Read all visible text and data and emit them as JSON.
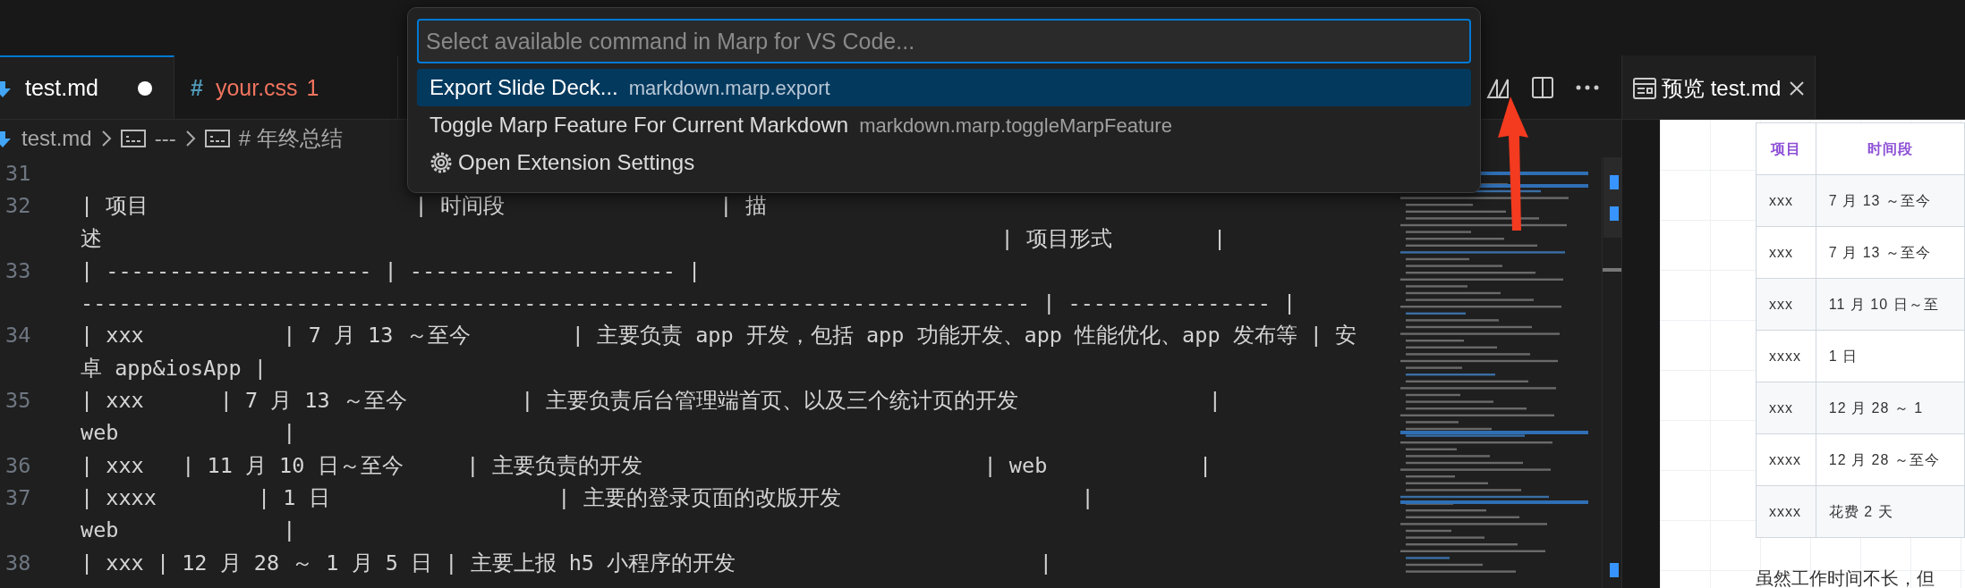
{
  "tabs": [
    {
      "label": "test.md",
      "kind": "markdown",
      "selected": true,
      "modified": true
    },
    {
      "label": "your.css",
      "kind": "css",
      "icon": "#",
      "badge": "1",
      "errors": true,
      "selected": false,
      "modified": false
    }
  ],
  "breadcrumbs": [
    {
      "label": "test.md",
      "kind": "file"
    },
    {
      "label": "---",
      "kind": "symbol"
    },
    {
      "label": "# 年终总结",
      "kind": "symbol"
    }
  ],
  "command_palette": {
    "placeholder": "Select available command in Marp for VS Code...",
    "items": [
      {
        "label": "Export Slide Deck...",
        "command": "markdown.marp.export",
        "kind": "command",
        "selected": true
      },
      {
        "label": "Toggle Marp Feature For Current Markdown",
        "command": "markdown.marp.toggleMarpFeature",
        "kind": "command",
        "selected": false
      },
      {
        "label": "Open Extension Settings",
        "kind": "settings",
        "selected": false
      }
    ]
  },
  "editor": {
    "lines": [
      {
        "number": "31"
      },
      {
        "number": "32",
        "rows": [
          "| 项目                     | 时间段                 | 描",
          "述                                                                       | 项目形式        |"
        ]
      },
      {
        "number": "33",
        "rows": [
          "| --------------------- | --------------------- |",
          "--------------------------------------------------------------------------- | ---------------- |"
        ]
      },
      {
        "number": "34",
        "rows": [
          "| xxx           | 7 月 13 ～至今        | 主要负责 app 开发，包括 app 功能开发、app 性能优化、app 发布等 | 安",
          "卓 app&iosApp |"
        ]
      },
      {
        "number": "35",
        "rows": [
          "| xxx      | 7 月 13 ～至今         | 主要负责后台管理端首页、以及三个统计页的开发               |",
          "web             |"
        ]
      },
      {
        "number": "36",
        "rows": [
          "| xxx   | 11 月 10 日～至今     | 主要负责的开发                           | web            |"
        ]
      },
      {
        "number": "37",
        "rows": [
          "| xxxx        | 1 日                  | 主要的登录页面的改版开发                   |",
          "web             |"
        ]
      },
      {
        "number": "38",
        "rows": [
          "| xxx | 12 月 28 ～ 1 月 5 日 | 主要上报 h5 小程序的开发                        |"
        ]
      }
    ]
  },
  "preview": {
    "tab": {
      "label": "预览 test.md",
      "selected": true
    },
    "table": {
      "columns": [
        "项目",
        "时间段"
      ],
      "rows": [
        [
          "xxx",
          "7 月 13 ～至今"
        ],
        [
          "xxx",
          "7 月 13 ～至今"
        ],
        [
          "xxx",
          "11 月 10 日～至"
        ],
        [
          "xxxx",
          "1 日"
        ],
        [
          "xxx",
          "12 月 28 ～ 1"
        ],
        [
          "xxxx",
          "12 月 28 ～至今"
        ],
        [
          "xxxx",
          "花费 2 天"
        ]
      ]
    },
    "paragraph": "虽然工作时间不长，但"
  }
}
